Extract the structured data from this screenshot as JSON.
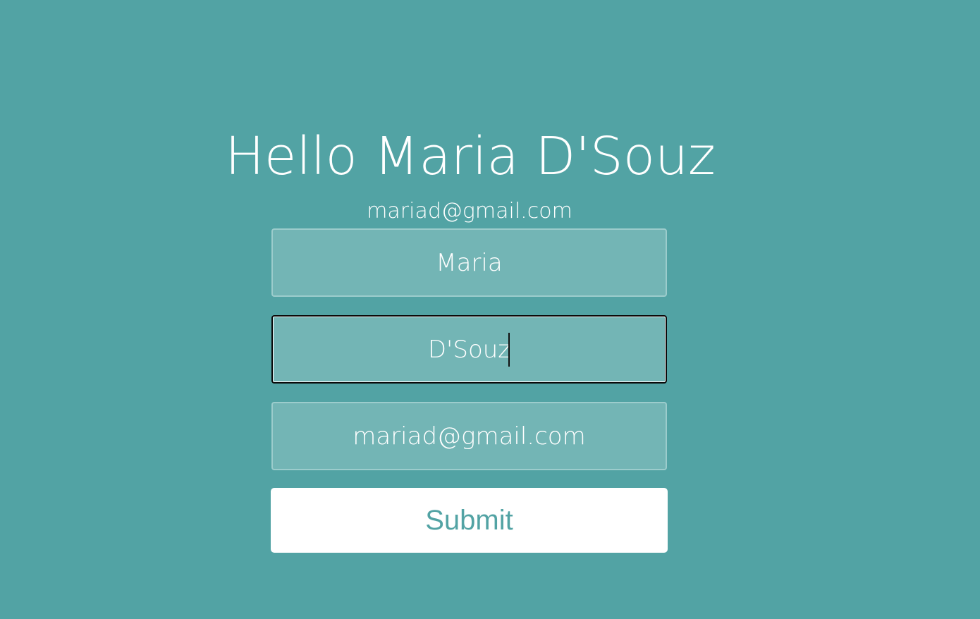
{
  "greeting": "Hello Maria D'Souz",
  "email_display": "mariad@gmail.com",
  "form": {
    "first_name": "Maria",
    "last_name": "D'Souz",
    "email": "mariad@gmail.com",
    "submit_label": "Submit"
  },
  "colors": {
    "background": "#52a3a4",
    "field_background": "#73b5b5",
    "button_background": "#ffffff",
    "button_text": "#52a3a4",
    "text": "#ffffff"
  }
}
